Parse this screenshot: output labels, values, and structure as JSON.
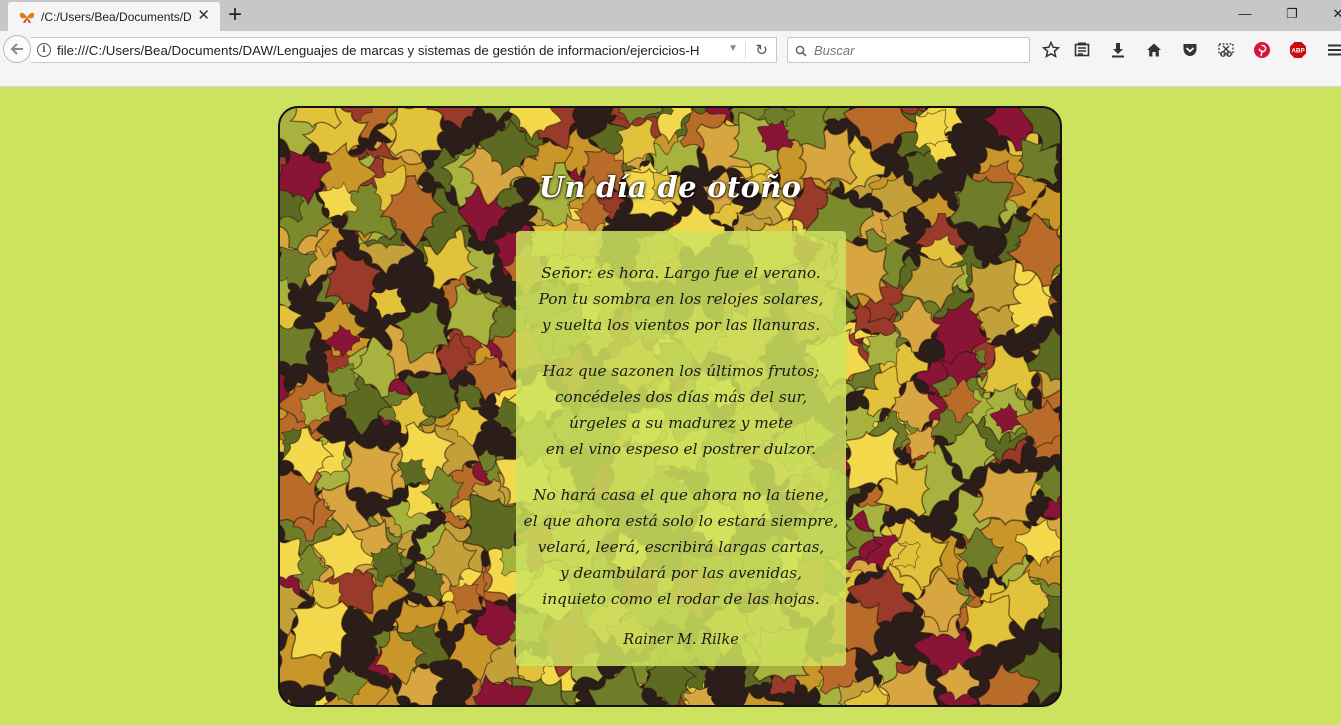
{
  "browser": {
    "tab": {
      "title": "/C:/Users/Bea/Documents/D",
      "favicon": "butterfly-icon"
    },
    "url": "file:///C:/Users/Bea/Documents/DAW/Lenguajes de marcas y sistemas de gestión de informacion/ejercicios-H",
    "search_placeholder": "Buscar",
    "window_controls": {
      "minimize": "—",
      "restore": "❐",
      "close": "✕"
    },
    "toolbar_icons": [
      "star-icon",
      "reading-list-icon",
      "download-icon",
      "home-icon",
      "pocket-icon",
      "screenshot-icon",
      "pinterest-icon",
      "adblock-icon",
      "menu-icon"
    ],
    "adblock_label": "ABP"
  },
  "page": {
    "background_color": "#cde35f",
    "title": "Un día de otoño",
    "stanzas": [
      [
        "Señor: es hora. Largo fue el verano.",
        "Pon tu sombra en los relojes solares,",
        "y suelta los vientos por las llanuras."
      ],
      [
        "Haz que sazonen los últimos frutos;",
        "concédeles dos días más del sur,",
        "úrgeles a su madurez y mete",
        "en el vino espeso el postrer dulzor."
      ],
      [
        "No hará casa el que ahora no la tiene,",
        "el que ahora está solo lo estará siempre,",
        "velará, leerá, escribirá largas cartas,",
        "y deambulará por las avenidas,",
        "inquieto como el rodar de las hojas."
      ]
    ],
    "author": "Rainer M. Rilke"
  }
}
